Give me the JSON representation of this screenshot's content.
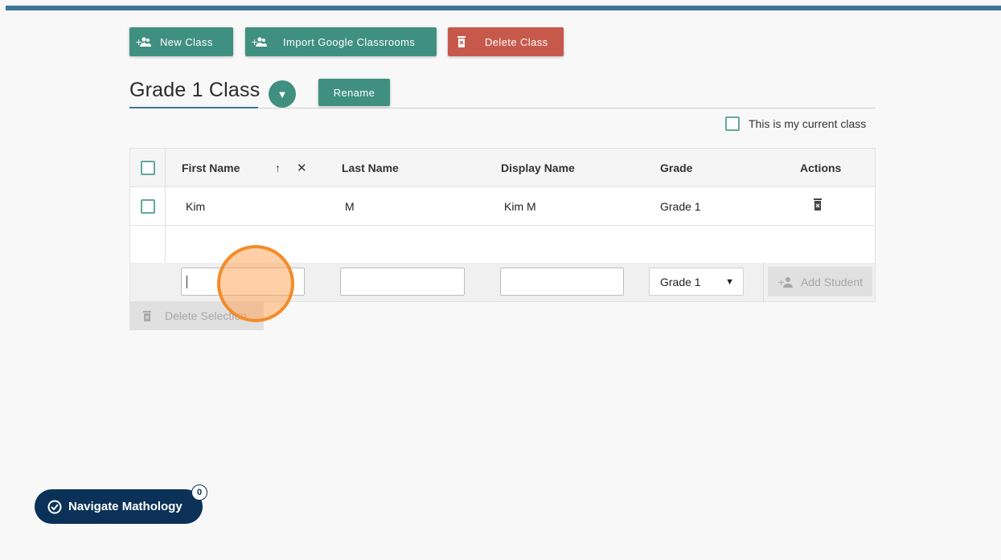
{
  "toolbar": {
    "new_class_label": "New Class",
    "import_label": "Import Google Classrooms",
    "delete_class_label": "Delete Class"
  },
  "class_header": {
    "title": "Grade 1 Class",
    "dropdown_glyph": "▼",
    "rename_label": "Rename",
    "current_class_label": "This is my current class",
    "current_class_checked": false
  },
  "table": {
    "columns": [
      "First Name",
      "Last Name",
      "Display Name",
      "Grade",
      "Actions"
    ],
    "sort_glyph": "↑",
    "clear_sort_glyph": "✕",
    "rows": [
      {
        "first_name": "Kim",
        "last_name": "M",
        "display_name": "Kim M",
        "grade": "Grade 1",
        "action_icon": "delete-icon"
      }
    ],
    "new_entry": {
      "first_name_value": "",
      "last_name_value": "",
      "display_name_value": "",
      "grade_selected": "Grade 1",
      "grade_arrow": "▼",
      "add_label": "Add Student"
    }
  },
  "delete_selection_label": "Delete Selection",
  "navigator": {
    "label": "Navigate Mathology",
    "badge_count": "0"
  },
  "colors": {
    "top_bar": "#3e7494",
    "primary_teal": "#3f9080",
    "danger_red": "#c7594c",
    "nav_navy": "#0b3158",
    "cursor_highlight": "#f28c28"
  }
}
